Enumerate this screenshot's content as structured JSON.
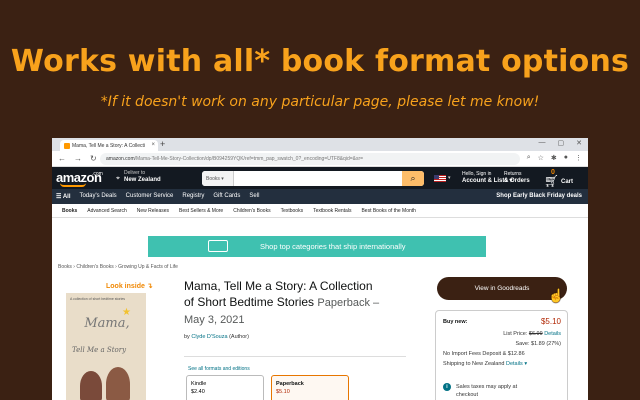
{
  "promo": {
    "headline": "Works with all* book format options",
    "footnote": "*If it doesn't work on any particular page, please let me know!"
  },
  "browser": {
    "tab_title": "Mama, Tell Me a Story: A Collecti",
    "tab_close": "×",
    "new_tab": "+",
    "window_controls": [
      "—",
      "▢",
      "✕"
    ],
    "url_host": "amazon.com",
    "url_path": "/Mama-Tell-Me-Story-Collection/dp/B094259YQK/ref=tmm_pap_swatch_0?_encoding=UTF8&qid=&sr="
  },
  "header": {
    "logo": "amazon",
    "logo_tld": ".com",
    "deliver_label": "Deliver to",
    "deliver_location": "New Zealand",
    "search_category": "Books ▾",
    "search_value": "",
    "account_greeting": "Hello, Sign in",
    "account_label": "Account & Lists ▾",
    "returns_label": "Returns",
    "orders_label": "& Orders",
    "cart_count": "0",
    "cart_label": "Cart"
  },
  "nav": {
    "items": [
      "☰ All",
      "Today's Deals",
      "Customer Service",
      "Registry",
      "Gift Cards",
      "Sell"
    ],
    "promo": "Shop Early Black Friday deals"
  },
  "subnav": {
    "items": [
      "Books",
      "Advanced Search",
      "New Releases",
      "Best Sellers & More",
      "Children's Books",
      "Textbooks",
      "Textbook Rentals",
      "Best Books of the Month"
    ]
  },
  "banner": {
    "text": "Shop top categories that ship internationally"
  },
  "breadcrumbs": "Books › Children's Books › Growing Up & Facts of Life",
  "cover": {
    "top_text": "A collection of short bedtime stories",
    "title": "Mama,",
    "subtitle": "Tell Me a Story",
    "look_inside": "Look inside ↴"
  },
  "product": {
    "title": "Mama, Tell Me a Story: A Collection of Short Bedtime Stories",
    "format": "Paperback – May 3, 2021",
    "by": "by",
    "author": "Clyde D'Souza",
    "role": "(Author)",
    "see_all": "See all formats and editions",
    "formats": [
      {
        "name": "Kindle",
        "price": "$2.40"
      },
      {
        "name": "Paperback",
        "price": "$5.10"
      }
    ]
  },
  "goodreads_button": "View in Goodreads",
  "buybox": {
    "buy_new": "Buy new:",
    "price": "$5.10",
    "list_price_label": "List Price:",
    "list_price": "$6.99",
    "details": "Details",
    "save": "Save: $1.89 (27%)",
    "import_fees": "No Import Fees Deposit & $12.86",
    "shipping": "Shipping to New Zealand",
    "shipping_details": "Details ▾",
    "tax_line1": "Sales taxes may apply at",
    "tax_line2": "checkout"
  }
}
